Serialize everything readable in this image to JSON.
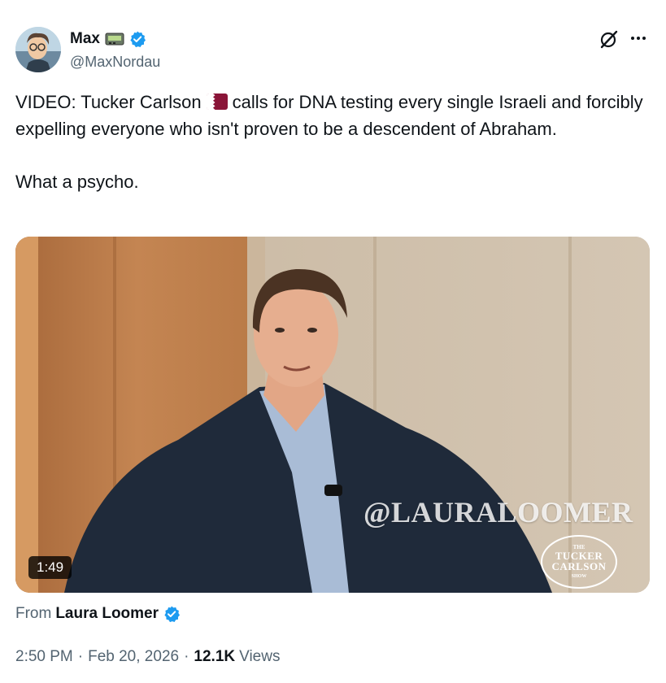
{
  "author": {
    "display_name": "Max",
    "handle": "@MaxNordau"
  },
  "icons": {
    "name_badge": "pager-icon",
    "verified": "verified-badge-icon",
    "grok": "grok-icon",
    "more": "more-options-icon",
    "flag": "qatar-flag-icon"
  },
  "tweet": {
    "line_before_flag": "VIDEO: Tucker Carlson",
    "line_after_flag": "calls for DNA testing every single Israeli and forcibly expelling everyone who isn't proven to be a descendent of Abraham.",
    "paragraph2": "What a psycho."
  },
  "video": {
    "duration": "1:49",
    "watermark": "@LAURALOOMER",
    "logo_top": "THE",
    "logo_main": "TUCKER CARLSON",
    "logo_bottom": "SHOW"
  },
  "source": {
    "prefix": "From",
    "name": "Laura Loomer"
  },
  "meta": {
    "time": "2:50 PM",
    "separator": "·",
    "date": "Feb 20, 2026",
    "views_count": "12.1K",
    "views_label": "Views"
  },
  "colors": {
    "text_primary": "#0f1419",
    "text_secondary": "#536471",
    "verified_blue": "#1d9bf0"
  }
}
